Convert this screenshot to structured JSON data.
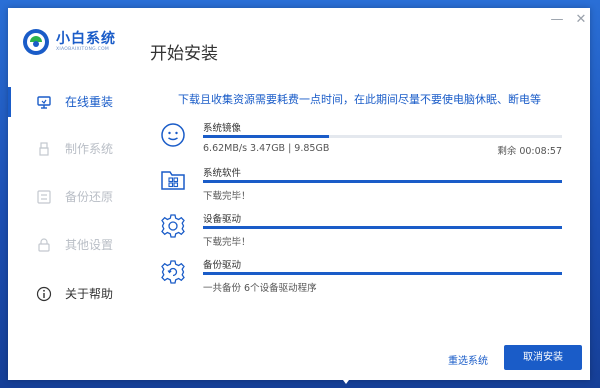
{
  "app": {
    "title": "小白系统",
    "subtitle": "XIAOBAIXITONG.COM",
    "page_title": "开始安装"
  },
  "window_controls": {
    "minimize": "—",
    "close": "✕"
  },
  "sidebar": {
    "items": [
      {
        "label": "在线重装",
        "icon": "monitor-icon",
        "active": true
      },
      {
        "label": "制作系统",
        "icon": "usb-icon",
        "active": false
      },
      {
        "label": "备份还原",
        "icon": "backup-icon",
        "active": false
      },
      {
        "label": "其他设置",
        "icon": "lock-icon",
        "active": false
      },
      {
        "label": "关于帮助",
        "icon": "info-icon",
        "active": false
      }
    ]
  },
  "notice": "下载且收集资源需要耗费一点时间，在此期间尽量不要使电脑休眠、断电等",
  "tasks": [
    {
      "name": "系统镜像",
      "status": "6.62MB/s 3.47GB | 9.85GB",
      "remaining": "剩余 00:08:57",
      "progress": 0.35,
      "icon": "disc-face-icon"
    },
    {
      "name": "系统软件",
      "status": "下载完毕！",
      "progress": 1.0,
      "icon": "folder-apps-icon"
    },
    {
      "name": "设备驱动",
      "status": "下载完毕！",
      "progress": 1.0,
      "icon": "gear-icon"
    },
    {
      "name": "备份驱动",
      "status": "一共备份 6个设备驱动程序",
      "progress": 1.0,
      "icon": "gear-backup-icon"
    }
  ],
  "buttons": {
    "reselect": "重选系统",
    "cancel": "取消安装"
  },
  "colors": {
    "accent": "#1a5cc8",
    "muted": "#b9bec6",
    "desktop": "#1c4fb3"
  }
}
